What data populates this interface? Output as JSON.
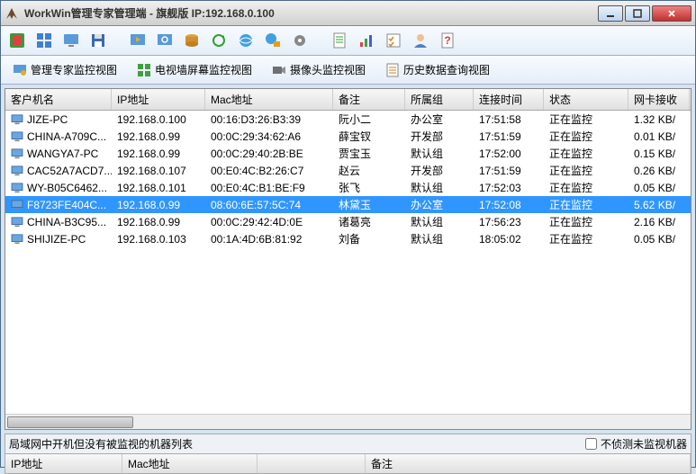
{
  "window": {
    "title": "WorkWin管理专家管理端 - 旗舰版 IP:192.168.0.100"
  },
  "tabs": [
    {
      "label": "管理专家监控视图"
    },
    {
      "label": "电视墙屏幕监控视图"
    },
    {
      "label": "摄像头监控视图"
    },
    {
      "label": "历史数据查询视图"
    }
  ],
  "columns": [
    "客户机名",
    "IP地址",
    "Mac地址",
    "备注",
    "所属组",
    "连接时间",
    "状态",
    "网卡接收"
  ],
  "rows": [
    {
      "name": "JIZE-PC",
      "ip": "192.168.0.100",
      "mac": "00:16:D3:26:B3:39",
      "note": "阮小二",
      "group": "办公室",
      "time": "17:51:58",
      "status": "正在监控",
      "nic": "1.32 KB/",
      "sel": false
    },
    {
      "name": "CHINA-A709C...",
      "ip": "192.168.0.99",
      "mac": "00:0C:29:34:62:A6",
      "note": "薛宝钗",
      "group": "开发部",
      "time": "17:51:59",
      "status": "正在监控",
      "nic": "0.01 KB/",
      "sel": false
    },
    {
      "name": "WANGYA7-PC",
      "ip": "192.168.0.99",
      "mac": "00:0C:29:40:2B:BE",
      "note": "贾宝玉",
      "group": "默认组",
      "time": "17:52:00",
      "status": "正在监控",
      "nic": "0.15 KB/",
      "sel": false
    },
    {
      "name": "CAC52A7ACD7...",
      "ip": "192.168.0.107",
      "mac": "00:E0:4C:B2:26:C7",
      "note": "赵云",
      "group": "开发部",
      "time": "17:51:59",
      "status": "正在监控",
      "nic": "0.26 KB/",
      "sel": false
    },
    {
      "name": "WY-B05C6462...",
      "ip": "192.168.0.101",
      "mac": "00:E0:4C:B1:BE:F9",
      "note": "张飞",
      "group": "默认组",
      "time": "17:52:03",
      "status": "正在监控",
      "nic": "0.05 KB/",
      "sel": false
    },
    {
      "name": "F8723FE404C...",
      "ip": "192.168.0.99",
      "mac": "08:60:6E:57:5C:74",
      "note": "林黛玉",
      "group": "办公室",
      "time": "17:52:08",
      "status": "正在监控",
      "nic": "5.62 KB/",
      "sel": true
    },
    {
      "name": "CHINA-B3C95...",
      "ip": "192.168.0.99",
      "mac": "00:0C:29:42:4D:0E",
      "note": "诸葛亮",
      "group": "默认组",
      "time": "17:56:23",
      "status": "正在监控",
      "nic": "2.16 KB/",
      "sel": false
    },
    {
      "name": "SHIJIZE-PC",
      "ip": "192.168.0.103",
      "mac": "00:1A:4D:6B:81:92",
      "note": "刘备",
      "group": "默认组",
      "time": "18:05:02",
      "status": "正在监控",
      "nic": "0.05 KB/",
      "sel": false
    }
  ],
  "bottom": {
    "label": "局域网中开机但没有被监视的机器列表",
    "checkbox": "不侦测未监视机器",
    "columns": [
      "IP地址",
      "Mac地址",
      "",
      "备注"
    ]
  },
  "toolbar_icons": [
    "config",
    "screens",
    "desktop",
    "floppy",
    "monitor-play",
    "monitor-search",
    "disk",
    "cycle",
    "globe",
    "globe-lock",
    "gear",
    "doc",
    "bars",
    "checklist",
    "user",
    "help"
  ]
}
